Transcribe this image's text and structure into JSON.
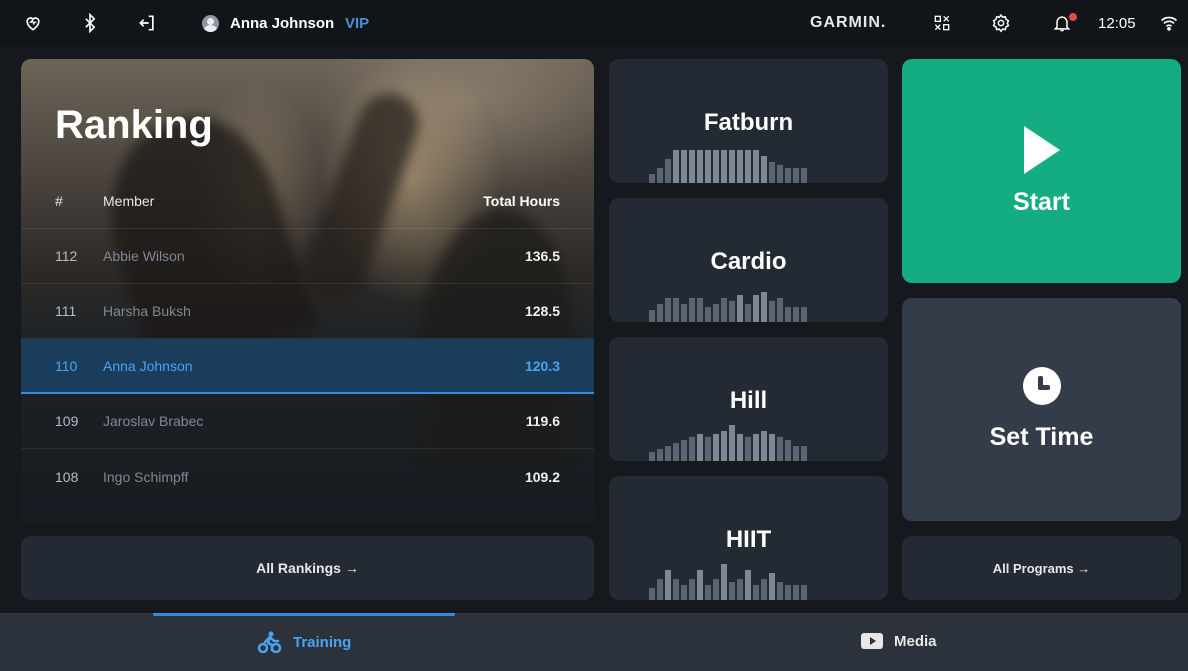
{
  "topbar": {
    "user_name": "Anna Johnson",
    "user_badge": "VIP",
    "brand": "GARMIN.",
    "time": "12:05",
    "icons": [
      "heart-icon",
      "bluetooth-icon",
      "logout-icon",
      "qr-code-icon",
      "gear-icon",
      "bell-icon",
      "wifi-icon"
    ]
  },
  "ranking": {
    "title": "Ranking",
    "columns": {
      "num": "#",
      "member": "Member",
      "hours": "Total Hours"
    },
    "rows": [
      {
        "num": "112",
        "member": "Abbie Wilson",
        "hours": "136.5"
      },
      {
        "num": "111",
        "member": "Harsha Buksh",
        "hours": "128.5"
      },
      {
        "num": "110",
        "member": "Anna Johnson",
        "hours": "120.3"
      },
      {
        "num": "109",
        "member": "Jaroslav Brabec",
        "hours": "119.6"
      },
      {
        "num": "108",
        "member": "Ingo Schimpff",
        "hours": "109.2"
      }
    ],
    "highlighted_row": "110",
    "all_label": "All Rankings →"
  },
  "programs": {
    "items": [
      "Fatburn",
      "Cardio",
      "Hill",
      "HIIT"
    ],
    "all_label": "All Programs →"
  },
  "actions": {
    "start_label": "Start",
    "settime_label": "Set Time"
  },
  "nav": {
    "training_label": "Training",
    "media_label": "Media",
    "active": "Training"
  },
  "colors": {
    "accent_blue": "#2e8fe0",
    "start_green": "#14ad82",
    "notification": "#e5484d"
  }
}
